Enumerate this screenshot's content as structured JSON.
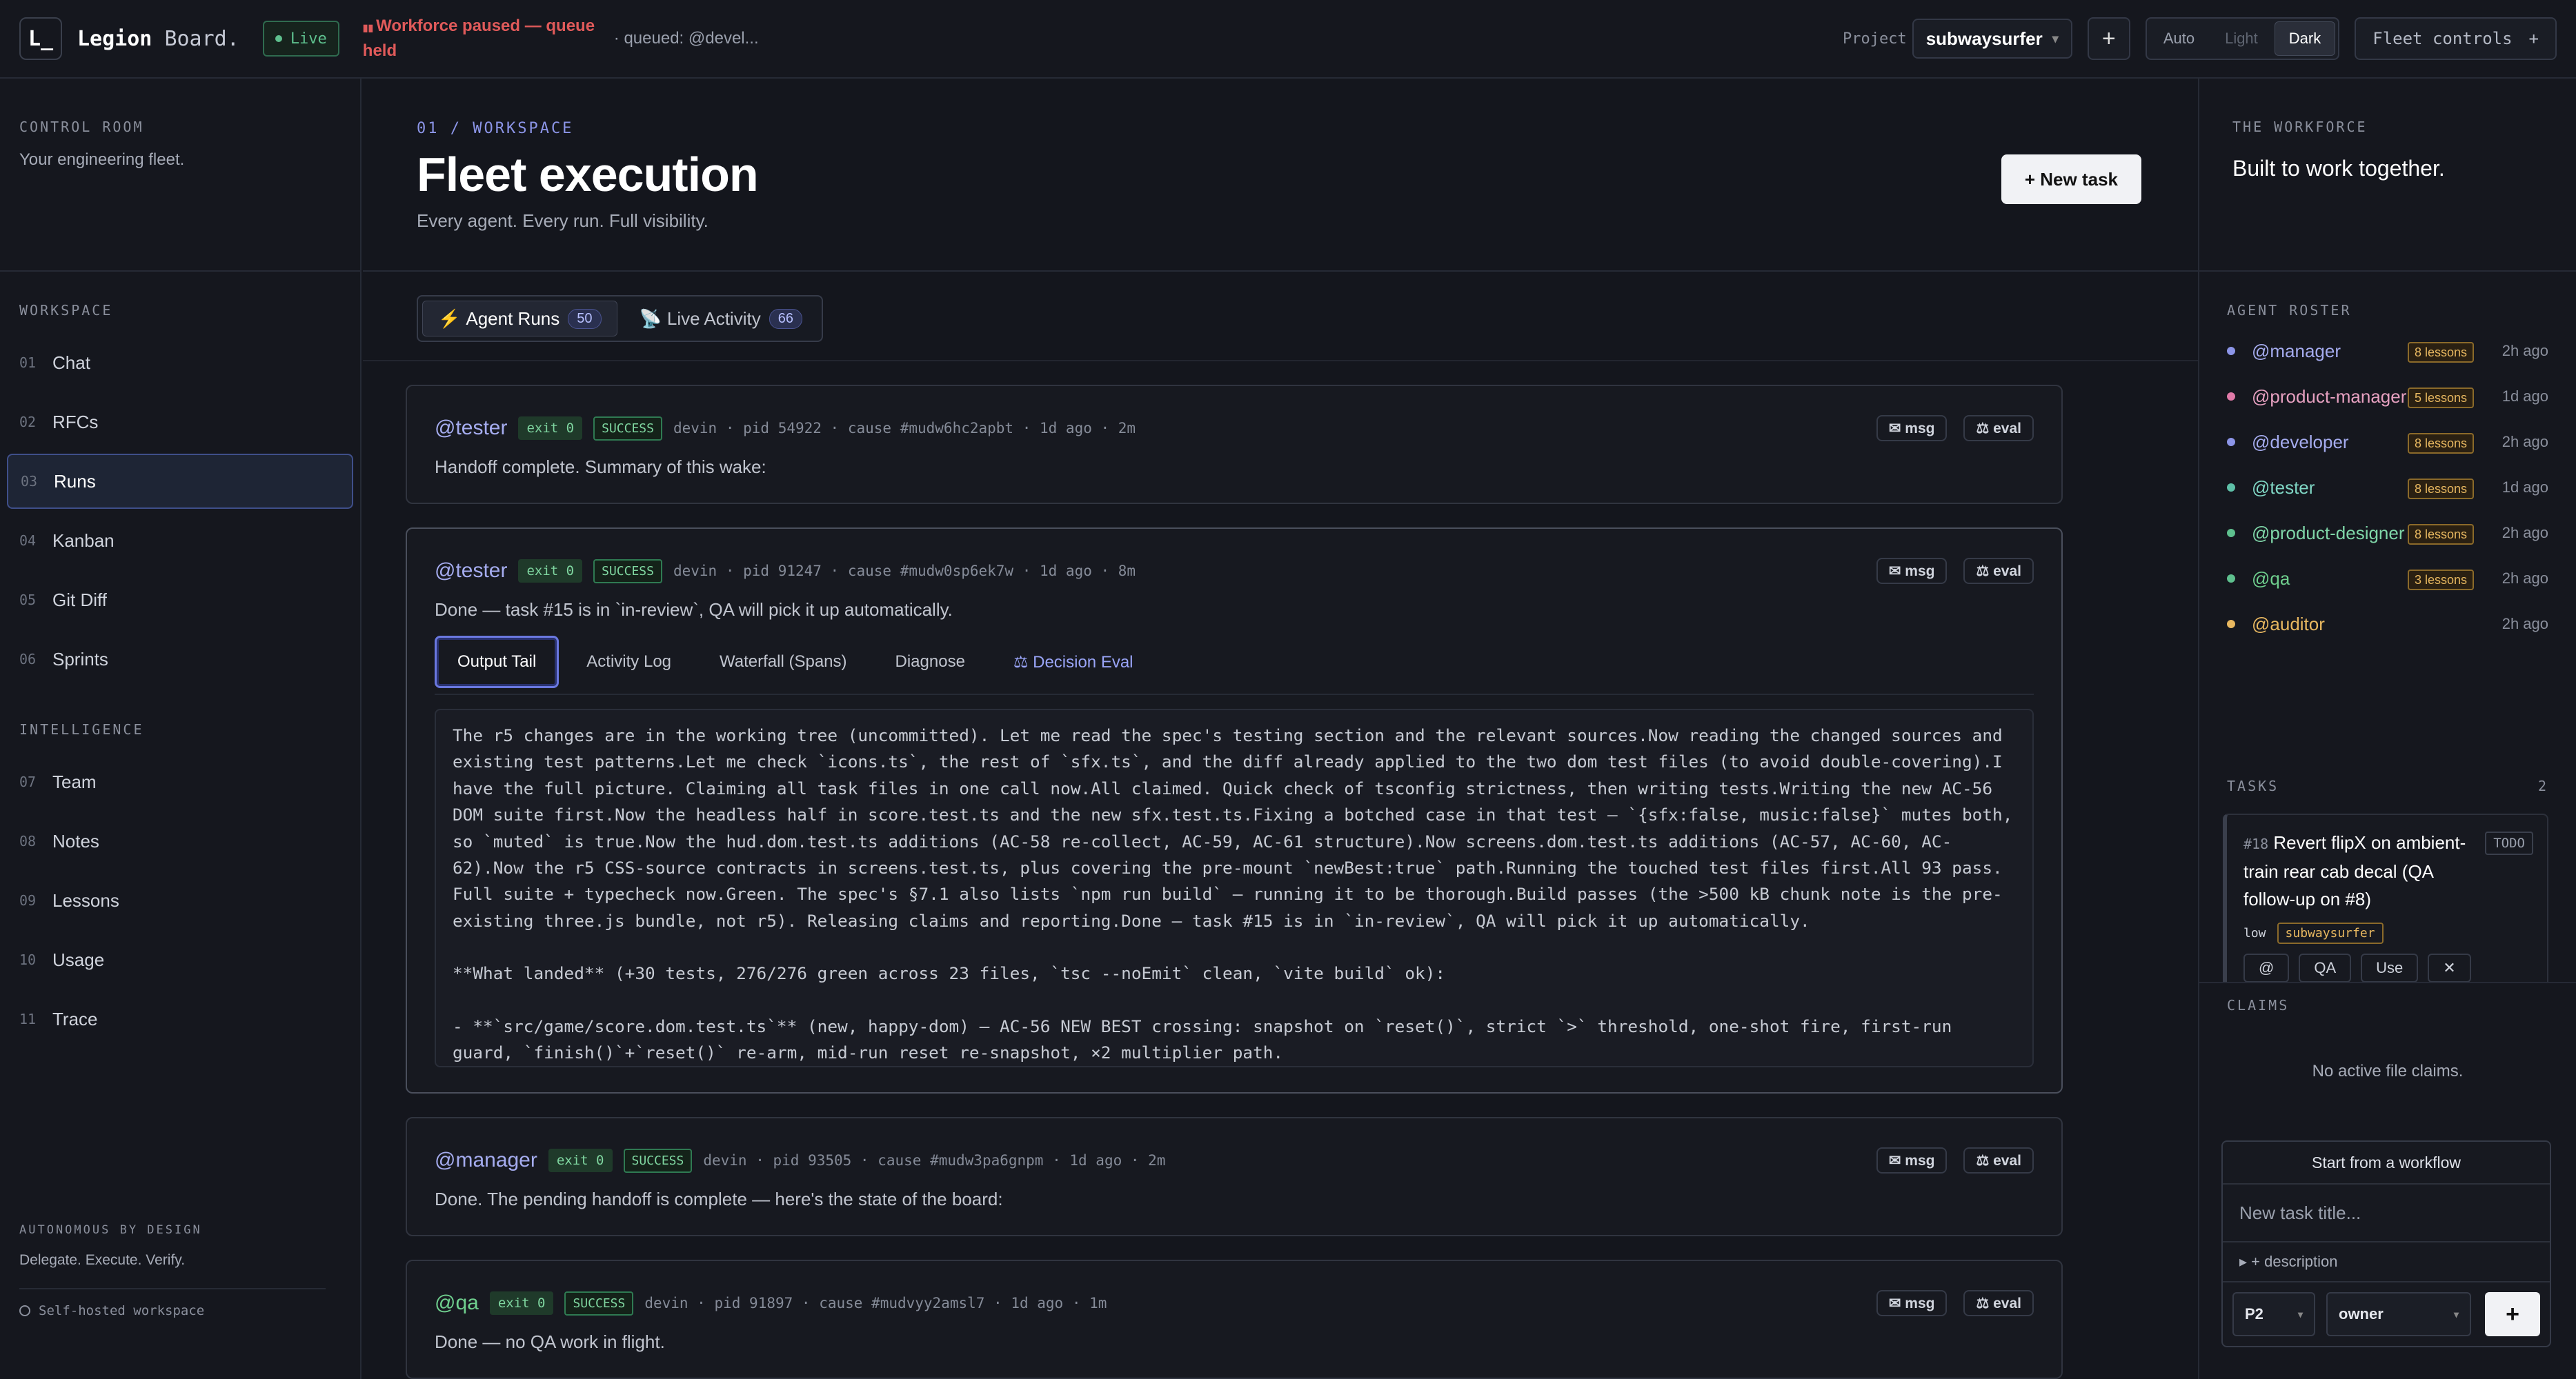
{
  "topbar": {
    "logo": "L_",
    "brand_main": "Legion",
    "brand_sub": "Board.",
    "live": "Live",
    "paused": "Workforce paused — queue held",
    "queued": "· queued: @devel...",
    "project_label": "Project",
    "project": "subwaysurfer",
    "add": "+",
    "theme": [
      "Auto",
      "Light",
      "Dark"
    ],
    "theme_selected": "Dark",
    "fleet_controls": "Fleet controls",
    "fleet_plus": "+"
  },
  "leftbar": {
    "control_room": "CONTROL ROOM",
    "control_sub": "Your engineering fleet.",
    "workspace_label": "WORKSPACE",
    "workspace": [
      {
        "num": "01",
        "label": "Chat"
      },
      {
        "num": "02",
        "label": "RFCs"
      },
      {
        "num": "03",
        "label": "Runs"
      },
      {
        "num": "04",
        "label": "Kanban"
      },
      {
        "num": "05",
        "label": "Git Diff"
      },
      {
        "num": "06",
        "label": "Sprints"
      }
    ],
    "intelligence_label": "INTELLIGENCE",
    "intelligence": [
      {
        "num": "07",
        "label": "Team"
      },
      {
        "num": "08",
        "label": "Notes"
      },
      {
        "num": "09",
        "label": "Lessons"
      },
      {
        "num": "10",
        "label": "Usage"
      },
      {
        "num": "11",
        "label": "Trace"
      }
    ],
    "footer_caps": "AUTONOMOUS BY DESIGN",
    "footer_sub": "Delegate. Execute. Verify.",
    "selfhosted": "Self-hosted workspace"
  },
  "main": {
    "eyebrow": "01 / WORKSPACE",
    "title": "Fleet execution",
    "desc": "Every agent. Every run. Full visibility.",
    "new_task": "+ New task",
    "tabs": [
      {
        "icon": "⚡",
        "label": "Agent Runs",
        "count": "50"
      },
      {
        "icon": "📡",
        "label": "Live Activity",
        "count": "66"
      }
    ],
    "cards": [
      {
        "agent": "@tester",
        "exit": "exit 0",
        "status": "SUCCESS",
        "meta": "devin · pid 54922 · cause #mudw6hc2apbt · 1d ago · 2m",
        "summary": "Handoff complete. Summary of this wake:"
      },
      {
        "agent": "@tester",
        "exit": "exit 0",
        "status": "SUCCESS",
        "meta": "devin · pid 91247 · cause #mudw0sp6ek7w · 1d ago · 8m",
        "summary": "Done — task #15 is in `in-review`, QA will pick it up automatically."
      },
      {
        "agent": "@manager",
        "exit": "exit 0",
        "status": "SUCCESS",
        "meta": "devin · pid 93505 · cause #mudw3pa6gnpm · 1d ago · 2m",
        "summary": "Done. The pending handoff is complete — here's the state of the board:"
      },
      {
        "agent": "@qa",
        "exit": "exit 0",
        "status": "SUCCESS",
        "meta": "devin · pid 91897 · cause #mudvyy2amsl7 · 1d ago · 1m",
        "summary": "Done — no QA work in flight."
      }
    ],
    "msg": "✉ msg",
    "eval": "⚖ eval",
    "subtabs": [
      "Output Tail",
      "Activity Log",
      "Waterfall (Spans)",
      "Diagnose",
      "⚖ Decision Eval"
    ],
    "output": [
      "The r5 changes are in the working tree (uncommitted). Let me read the spec's testing section and the relevant sources.Now reading the changed sources and existing test patterns.Let me check `icons.ts`, the rest of `sfx.ts`, and the diff already applied to the two dom test files (to avoid double-covering).I have the full picture. Claiming all task files in one call now.All claimed. Quick check of tsconfig strictness, then writing tests.Writing the new AC-56 DOM suite first.Now the headless half in score.test.ts and the new sfx.test.ts.Fixing a botched case in that test — `{sfx:false, music:false}` mutes both, so `muted` is true.Now the hud.dom.test.ts additions (AC-58 re-collect, AC-59, AC-61 structure).Now screens.dom.test.ts additions (AC-57, AC-60, AC-62).Now the r5 CSS-source contracts in screens.test.ts, plus covering the pre-mount `newBest:true` path.Running the touched test files first.All 93 pass. Full suite + typecheck now.Green. The spec's §7.1 also lists `npm run build` — running it to be thorough.Build passes (the >500 kB chunk note is the pre-existing three.js bundle, not r5). Releasing claims and reporting.Done — task #15 is in `in-review`, QA will pick it up automatically.",
      "**What landed** (+30 tests, 276/276 green across 23 files, `tsc --noEmit` clean, `vite build` ok):",
      "- **`src/game/score.dom.test.ts`** (new, happy-dom) — AC-56 NEW BEST crossing: snapshot on `reset()`, strict `>` threshold, one-shot fire, first-run guard, `finish()`+`reset()` re-arm, mid-run reset re-snapshot, ×2 multiplier path."
    ]
  },
  "rightbar": {
    "workforce_label": "THE WORKFORCE",
    "workforce_title": "Built to work together.",
    "roster_label": "AGENT ROSTER",
    "roster": [
      {
        "name": "@manager",
        "lessons": "8 lessons",
        "time": "2h ago",
        "color": "#a5acef",
        "dot": "#8c95e8"
      },
      {
        "name": "@product-manager",
        "lessons": "5 lessons",
        "time": "1d ago",
        "color": "#e6a0c0",
        "dot": "#e07aa8"
      },
      {
        "name": "@developer",
        "lessons": "8 lessons",
        "time": "2h ago",
        "color": "#a5acef",
        "dot": "#8c95e8"
      },
      {
        "name": "@tester",
        "lessons": "8 lessons",
        "time": "1d ago",
        "color": "#7fd6c4",
        "dot": "#5ec0a8"
      },
      {
        "name": "@product-designer",
        "lessons": "8 lessons",
        "time": "2h ago",
        "color": "#7fd6a8",
        "dot": "#5ec08e"
      },
      {
        "name": "@qa",
        "lessons": "3 lessons",
        "time": "2h ago",
        "color": "#6fcf8e",
        "dot": "#5ec08e"
      },
      {
        "name": "@auditor",
        "lessons": "",
        "time": "2h ago",
        "color": "#e8b860",
        "dot": "#e8b860"
      }
    ],
    "tasks_label": "TASKS",
    "tasks_count": "2",
    "task": {
      "id": "#18",
      "title": "Revert flipX on ambient-train rear cab decal (QA follow-up on #8)",
      "status": "TODO",
      "priority": "low",
      "project": "subwaysurfer",
      "buttons": [
        "@",
        "QA",
        "Use"
      ]
    },
    "claims_label": "CLAIMS",
    "no_claims": "No active file claims.",
    "workflow": "Start from a workflow",
    "new_task_placeholder": "New task title...",
    "add_description": "▸ + description",
    "priority": "P2",
    "owner": "owner",
    "add": "+"
  }
}
